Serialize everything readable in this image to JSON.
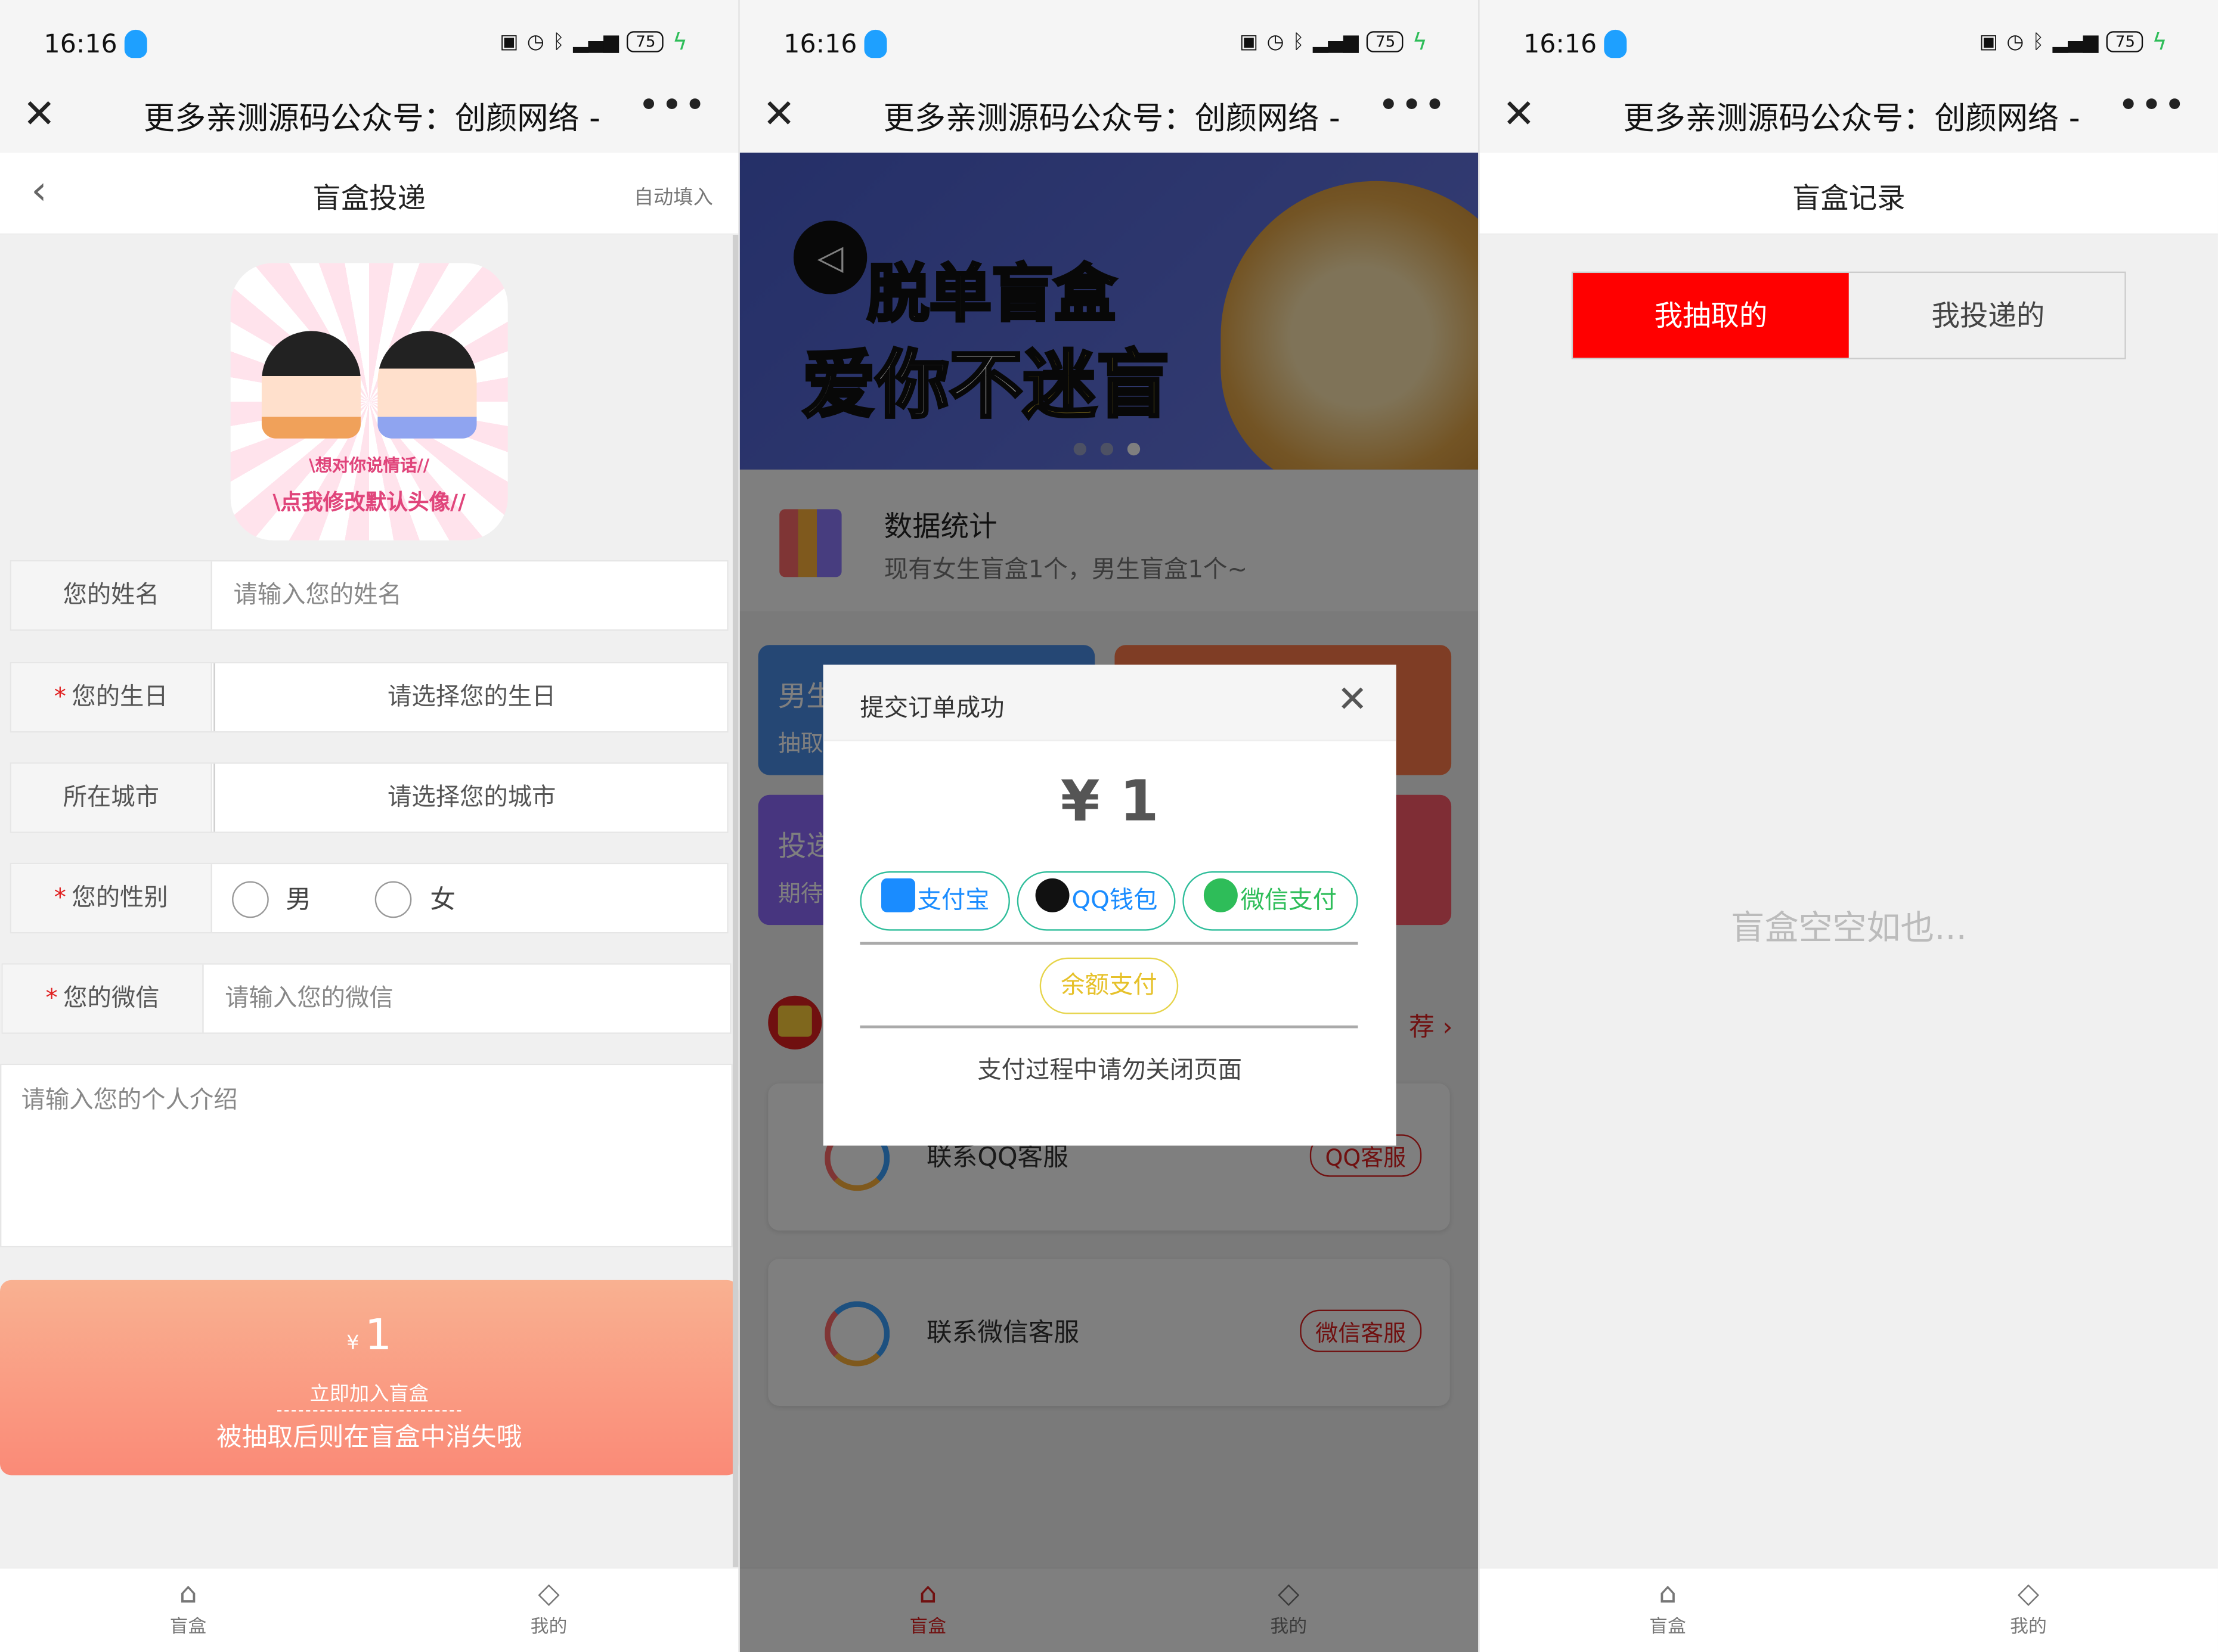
{
  "status_bar": {
    "time": "16:16",
    "battery": "75"
  },
  "wechat_header": {
    "title": "更多亲测源码公众号：创颜网络 -",
    "more": "•••"
  },
  "panel1": {
    "header": {
      "title": "盲盒投递",
      "auto_fill": "自动填入"
    },
    "avatar": {
      "line1": "\\想对你说情话//",
      "line2": "\\点我修改默认头像//"
    },
    "name": {
      "label": "您的姓名",
      "placeholder": "请输入您的姓名"
    },
    "birthday": {
      "label": "您的生日",
      "placeholder": "请选择您的生日"
    },
    "city": {
      "label": "所在城市",
      "placeholder": "请选择您的城市"
    },
    "gender": {
      "label": "您的性别",
      "male": "男",
      "female": "女"
    },
    "wechat": {
      "label": "您的微信",
      "placeholder": "请输入您的微信"
    },
    "intro": {
      "placeholder": "请输入您的个人介绍"
    },
    "join": {
      "currency": "¥",
      "price": "1",
      "action": "立即加入盲盒",
      "note": "被抽取后则在盲盒中消失哦"
    }
  },
  "panel2": {
    "banner": {
      "line1": "脱单盲盒",
      "line2a": "爱你不",
      "line2b": "迷盲"
    },
    "stats": {
      "title": "数据统计",
      "subtitle": "现有女生盲盒1个，男生盲盒1个~"
    },
    "cards": [
      {
        "title": "男生",
        "sub": "抽取",
        "color": "#4a8fe8"
      },
      {
        "title": "",
        "sub": "",
        "color": "#ff7a4a"
      },
      {
        "title": "投递",
        "sub": "期待",
        "color": "#8f6bff"
      },
      {
        "title": "",
        "sub": "",
        "color": "#ff5a6a"
      }
    ],
    "recommend": "荐 ›",
    "services": [
      {
        "title": "联系QQ客服",
        "button": "QQ客服"
      },
      {
        "title": "联系微信客服",
        "button": "微信客服"
      }
    ],
    "modal": {
      "title": "提交订单成功",
      "amount": "¥ 1",
      "alipay": "支付宝",
      "qq": "QQ钱包",
      "wechat": "微信支付",
      "balance": "余额支付",
      "note": "支付过程中请勿关闭页面"
    }
  },
  "panel3": {
    "header": {
      "title": "盲盒记录"
    },
    "tabs": {
      "drawn": "我抽取的",
      "delivered": "我投递的"
    },
    "empty": "盲盒空空如也..."
  },
  "bottom_nav": {
    "box": "盲盒",
    "mine": "我的"
  },
  "colors": {
    "accent_red": "#e02020",
    "tab_red": "#ff0000",
    "join_gradient_top": "#f9b191",
    "join_gradient_bottom": "#fa8a77"
  }
}
